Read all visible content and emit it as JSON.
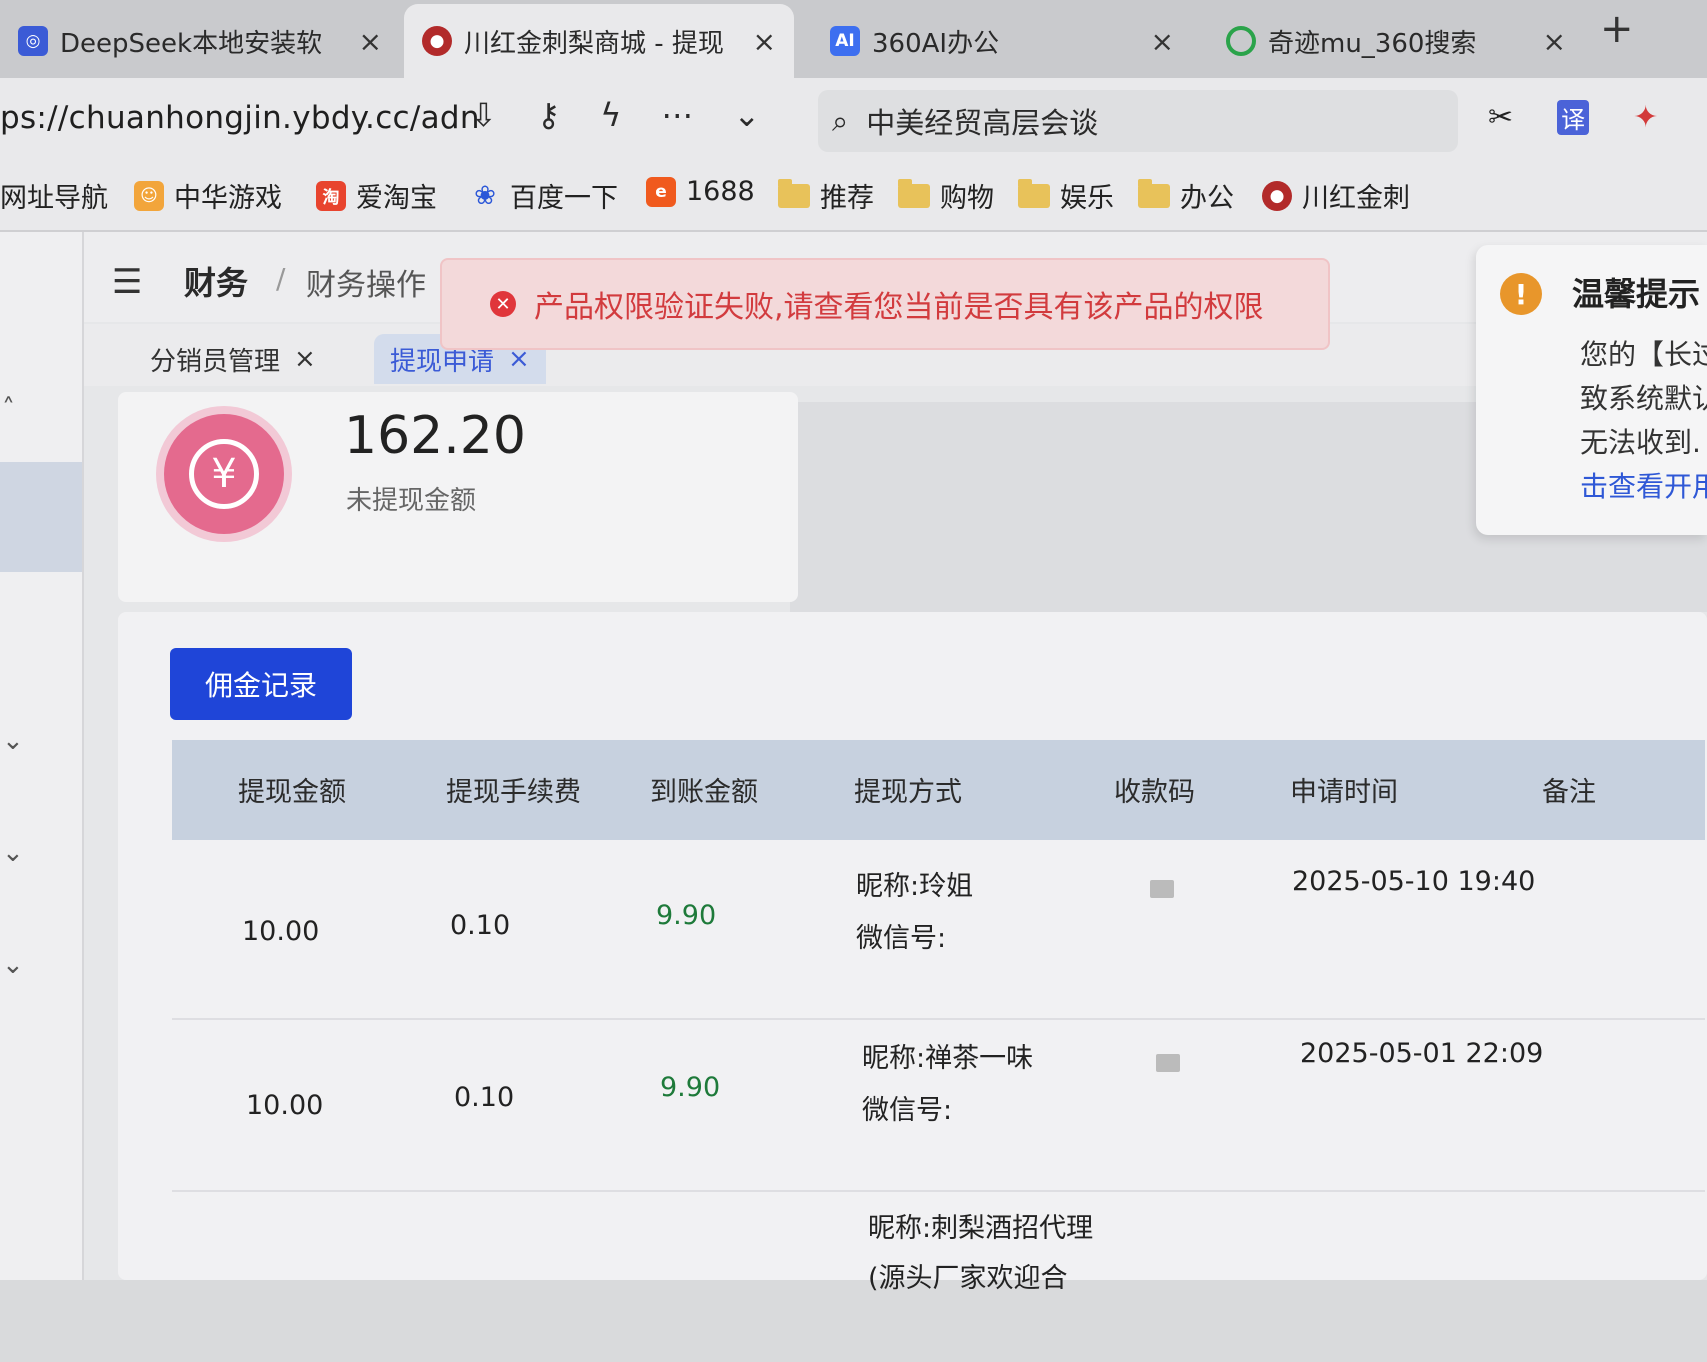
{
  "browser": {
    "tabs": [
      {
        "label": "DeepSeek本地安装软",
        "icon": "deepseek-icon"
      },
      {
        "label": "川红金刺梨商城 - 提现",
        "icon": "shop-logo-icon"
      },
      {
        "label": "360AI办公",
        "icon": "ai-badge-icon",
        "badge": "AI"
      },
      {
        "label": "奇迹mu_360搜索",
        "icon": "360-search-icon"
      }
    ],
    "close_glyph": "×",
    "new_tab_glyph": "+",
    "url": "ps://chuanhongjin.ybdy.cc/adn",
    "search_text": "中美经贸高层会谈",
    "bookmarks": [
      {
        "label": "网址导航",
        "icon": ""
      },
      {
        "label": "中华游戏",
        "icon": "game-icon"
      },
      {
        "label": "爱淘宝",
        "icon": "taobao-icon",
        "badge": "淘"
      },
      {
        "label": "百度一下",
        "icon": "baidu-paw-icon"
      },
      {
        "label": "1688",
        "icon": "1688-icon"
      },
      {
        "label": "推荐",
        "icon": "folder-icon"
      },
      {
        "label": "购物",
        "icon": "folder-icon"
      },
      {
        "label": "娱乐",
        "icon": "folder-icon"
      },
      {
        "label": "办公",
        "icon": "folder-icon"
      },
      {
        "label": "川红金刺",
        "icon": "shop-logo-icon"
      }
    ]
  },
  "header": {
    "breadcrumb_root": "财务",
    "breadcrumb_sep": "/",
    "breadcrumb_child": "财务操作"
  },
  "page_tabs": [
    {
      "label": "分销员管理",
      "active": false
    },
    {
      "label": "提现申请",
      "active": true
    }
  ],
  "balance": {
    "amount": "162.20",
    "label": "未提现金额",
    "icon_glyph": "¥"
  },
  "actions": {
    "commission_button": "佣金记录"
  },
  "table": {
    "columns": [
      "提现金额",
      "提现手续费",
      "到账金额",
      "提现方式",
      "收款码",
      "申请时间",
      "备注"
    ],
    "rows": [
      {
        "amount": "10.00",
        "fee": "0.10",
        "received": "9.90",
        "method_line1": "昵称:玲姐",
        "method_line2": "微信号:",
        "time": "2025-05-10 19:40"
      },
      {
        "amount": "10.00",
        "fee": "0.10",
        "received": "9.90",
        "method_line1": "昵称:禅茶一味",
        "method_line2": "微信号:",
        "time": "2025-05-01 22:09"
      },
      {
        "amount": "",
        "fee": "",
        "received": "",
        "method_line1": "昵称:刺梨酒招代理",
        "method_line2": "(源头厂家欢迎合",
        "time": ""
      }
    ]
  },
  "toast": {
    "message": "产品权限验证失败,请查看您当前是否具有该产品的权限",
    "color": "#d23b3e"
  },
  "notice": {
    "title": "温馨提示",
    "lines": [
      "您的【长过",
      "致系统默认",
      "无法收到.",
      "击查看开用"
    ]
  },
  "colors": {
    "primary": "#1f45d8",
    "coin": "#e46a8e",
    "warning": "#e8962b"
  }
}
